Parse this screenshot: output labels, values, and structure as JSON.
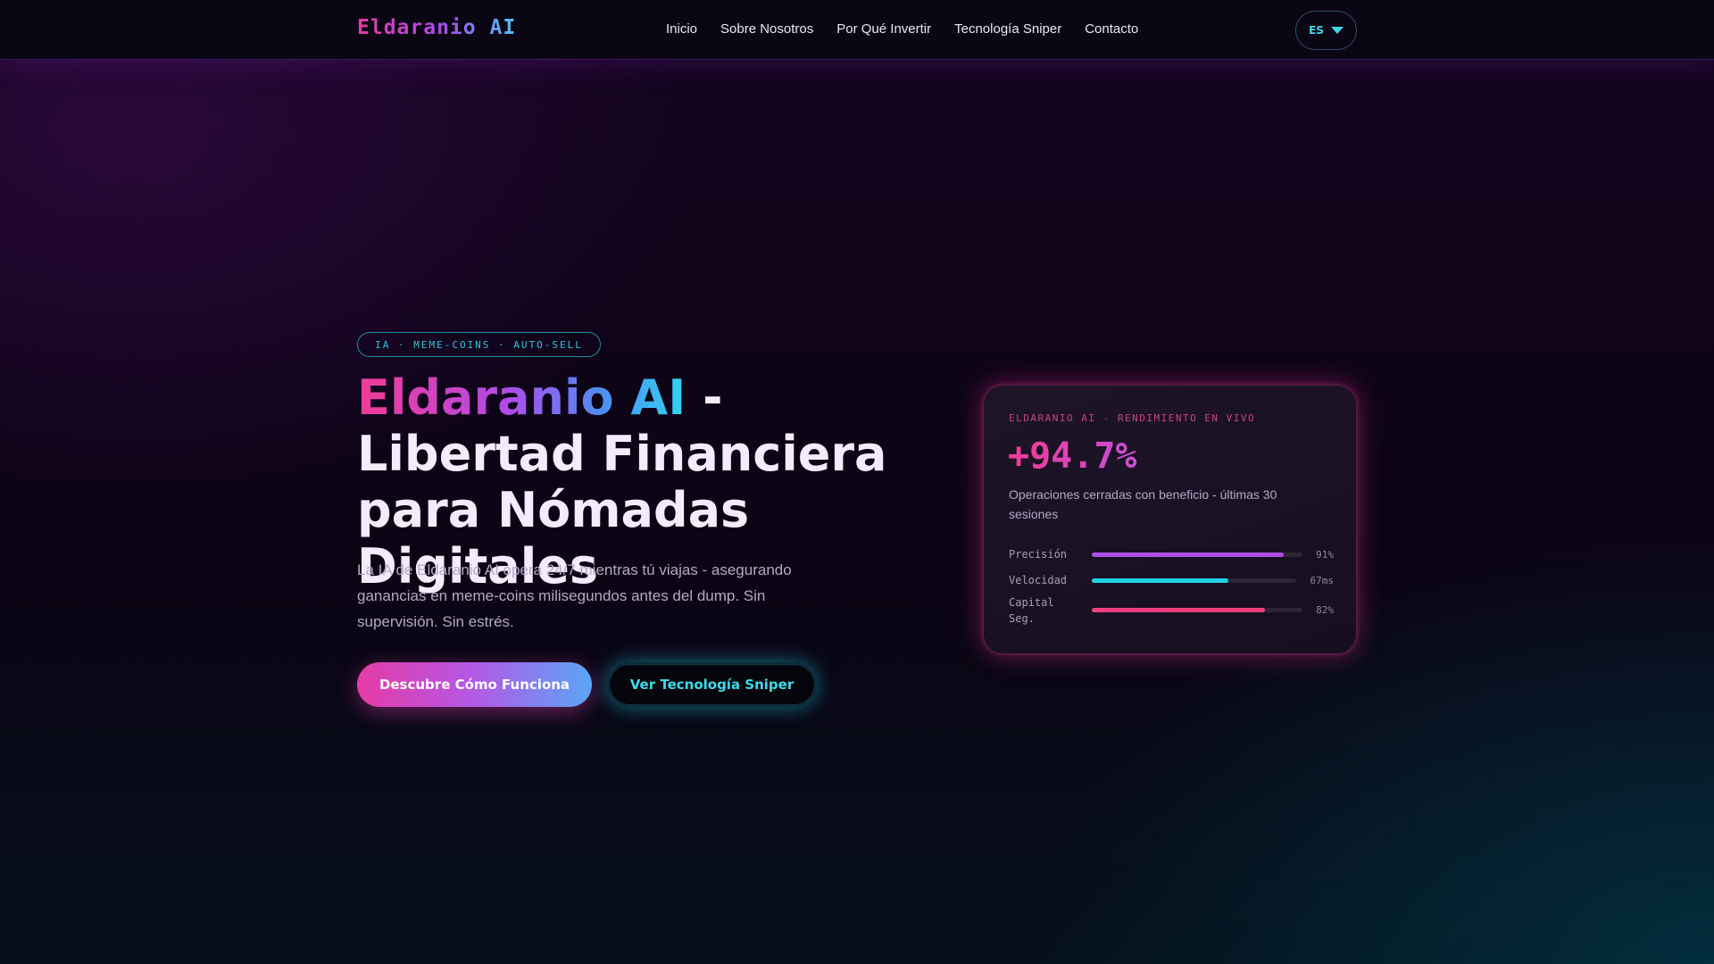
{
  "nav": {
    "logo": "Eldaranio AI",
    "links": [
      "Inicio",
      "Sobre Nosotros",
      "Por Qué Invertir",
      "Tecnología Sniper",
      "Contacto"
    ],
    "language": "ES"
  },
  "hero": {
    "tag": "IA · MEME-COINS · AUTO-SELL",
    "title_brand": "Eldaranio AI",
    "title_rest": " - Libertad Financiera",
    "title_line2": "para Nómadas Digitales",
    "subtitle": "La IA de Eldaranio AI opera 24/7 mientras tú viajas - asegurando ganancias en meme-coins milisegundos antes del dump. Sin supervisión. Sin estrés.",
    "primary_button": "Descubre Cómo Funciona",
    "secondary_button": "Ver Tecnología Sniper"
  },
  "card": {
    "label": "ELDARANIO AI - RENDIMIENTO EN VIVO",
    "value": "+94.7%",
    "description": "Operaciones cerradas con beneficio - últimas 30 sesiones",
    "metrics": [
      {
        "label": "Precisión",
        "value": "91%",
        "level": 0.91,
        "color": "#b04ee8"
      },
      {
        "label": "Velocidad",
        "value": "67ms",
        "level": 0.67,
        "color": "#22d3e6"
      },
      {
        "label": "Capital Seg.",
        "value": "82%",
        "level": 0.82,
        "color": "#f0407e"
      }
    ]
  },
  "colors": {
    "accent_pink": "#e63ba0",
    "accent_purple": "#a64bf0",
    "accent_cyan": "#3fd6e8"
  }
}
